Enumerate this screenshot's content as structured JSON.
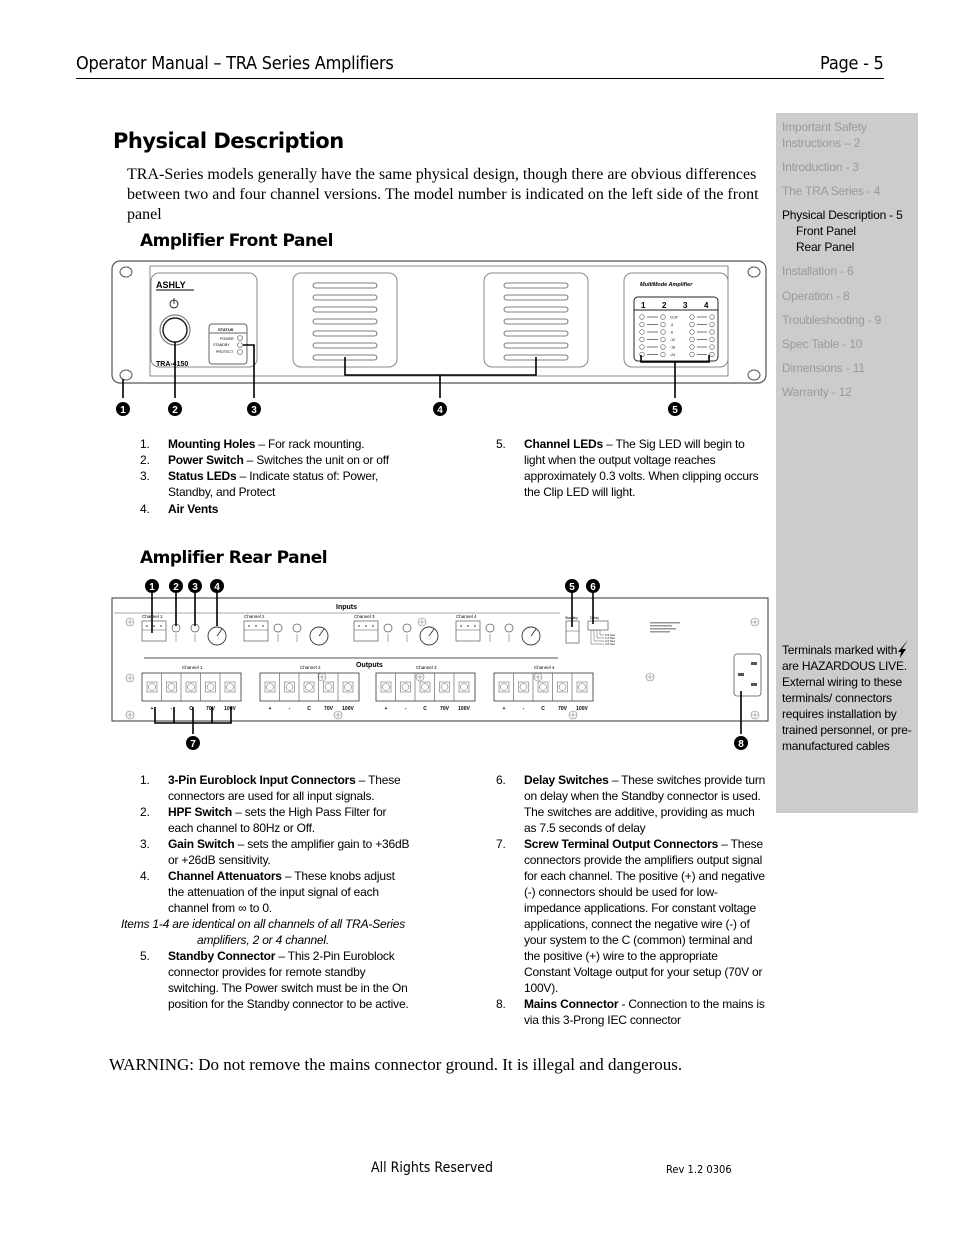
{
  "header": {
    "title": "Operator Manual – TRA Series Amplifiers",
    "page": "Page - 5"
  },
  "sidebar": {
    "items": [
      {
        "label": "Important Safety Instructions – 2",
        "active": false
      },
      {
        "label": "Introduction - 3",
        "active": false
      },
      {
        "label": "The TRA Series - 4",
        "active": false
      },
      {
        "label": "Physical Description - 5",
        "active": true,
        "sub": [
          "Front Panel",
          "Rear Panel"
        ]
      },
      {
        "label": "Installation - 6",
        "active": false
      },
      {
        "label": "Operation - 8",
        "active": false
      },
      {
        "label": "Troubleshooting - 9",
        "active": false
      },
      {
        "label": "Spec Table - 10",
        "active": false
      },
      {
        "label": "Dimensions - 11",
        "active": false
      },
      {
        "label": "Warranty - 12",
        "active": false
      }
    ],
    "hazard_note": {
      "before": "Terminals marked with",
      "icon": "lightning-bolt-icon",
      "after": "are HAZARDOUS LIVE. External wiring to these terminals/ connectors requires installation by trained personnel, or pre-manufactured cables"
    }
  },
  "main": {
    "title": "Physical Description",
    "intro": "TRA-Series models generally have the same physical design, though there are obvious differences between two and four channel versions.  The model number is indicated on the left side of the front panel",
    "front_panel": {
      "heading": "Amplifier Front Panel",
      "figure": {
        "brand": "ASHLY",
        "model": "TRA-4150",
        "status_title": "STATUS",
        "status_leds": [
          "POWER",
          "STANDBY",
          "PROTECT"
        ],
        "meter_title": "MultiMode Amplifier",
        "channels": [
          "1",
          "2",
          "3",
          "4"
        ],
        "meter_levels": [
          "CLIP",
          "-3",
          "-6",
          "-12",
          "-18",
          "-24"
        ],
        "callouts": [
          "1",
          "2",
          "3",
          "4",
          "5"
        ]
      },
      "items": [
        {
          "num": "1.",
          "term": "Mounting Holes",
          "desc": " – For rack mounting."
        },
        {
          "num": "2.",
          "term": "Power Switch",
          "desc": " – Switches the unit on or off"
        },
        {
          "num": "3.",
          "term": "Status LEDs",
          "desc": " – Indicate status of: Power, Standby, and Protect"
        },
        {
          "num": "4.",
          "term": "Air Vents",
          "desc": ""
        },
        {
          "num": "5.",
          "term": "Channel LEDs",
          "desc": " – The Sig LED will begin to light when the output voltage reaches approximately 0.3 volts.  When clipping occurs the Clip LED will light."
        }
      ]
    },
    "rear_panel": {
      "heading": "Amplifier Rear Panel",
      "figure": {
        "inputs_label": "Inputs",
        "outputs_label": "Outputs",
        "channels": [
          "Channel 1",
          "Channel 2",
          "Channel 3",
          "Channel 4"
        ],
        "output_terminals": [
          "+",
          "-",
          "C",
          "70V",
          "100V"
        ],
        "standby_label": "Standby",
        "delay_label": "Delay",
        "delay_options": [
          "0.5 Sec",
          "1.0 Sec",
          "2.0 Sec",
          "4.0 Sec"
        ],
        "callouts": [
          "1",
          "2",
          "3",
          "4",
          "5",
          "6",
          "7",
          "8"
        ]
      },
      "items_left": [
        {
          "num": "1.",
          "term": "3-Pin Euroblock Input Connectors",
          "desc": " – These connectors are used for all input signals."
        },
        {
          "num": "2.",
          "term": "HPF Switch",
          "desc": " – sets the High Pass Filter for each channel to 80Hz or Off."
        },
        {
          "num": "3.",
          "term": "Gain Switch",
          "desc": " – sets the amplifier gain to +36dB or +26dB sensitivity."
        },
        {
          "num": "4.",
          "term": "Channel Attenuators",
          "desc": " – These knobs adjust the attenuation of the input signal of each channel from ∞ to 0."
        }
      ],
      "note": "Items 1-4 are identical on all channels of all TRA-Series amplifiers, 2 or 4 channel.",
      "item5": {
        "num": "5.",
        "term": "Standby Connector",
        "desc": " – This 2-Pin Euroblock connector provides for remote standby switching.  The Power switch must be in the On position for the Standby connector to be active."
      },
      "items_right": [
        {
          "num": "6.",
          "term": "Delay Switches",
          "desc": " – These switches provide turn on delay when the Standby connector is used. The switches are additive, providing as much as 7.5 seconds of delay"
        },
        {
          "num": "7.",
          "term": "Screw Terminal Output Connectors",
          "desc": " – These connectors provide the amplifiers output signal for each channel.  The positive (+) and negative (-) connectors should be used for low-impedance applications.  For constant voltage applications, connect the negative wire (-) of your system to the C (common) terminal and the positive (+) wire to the appropriate Constant Voltage output for your setup (70V or 100V)."
        },
        {
          "num": "8.",
          "term": "Mains Connector",
          "desc": " - Connection to the mains is via this 3-Prong IEC connector"
        }
      ]
    },
    "warning": "WARNING: Do not remove the mains connector ground.  It is illegal and dangerous."
  },
  "footer": {
    "rights": "All Rights Reserved",
    "rev": "Rev 1.2 0306"
  }
}
